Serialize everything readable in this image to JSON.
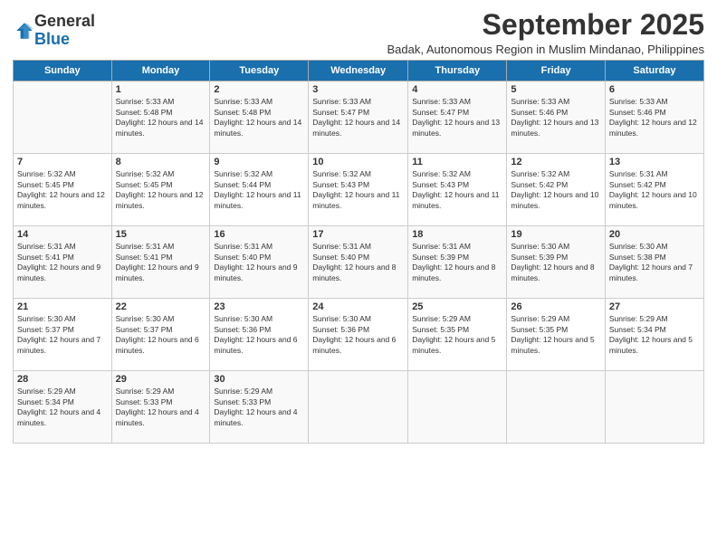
{
  "header": {
    "logo_line1": "General",
    "logo_line2": "Blue",
    "month": "September 2025",
    "location": "Badak, Autonomous Region in Muslim Mindanao, Philippines"
  },
  "days_of_week": [
    "Sunday",
    "Monday",
    "Tuesday",
    "Wednesday",
    "Thursday",
    "Friday",
    "Saturday"
  ],
  "weeks": [
    [
      {
        "day": "",
        "sunrise": "",
        "sunset": "",
        "daylight": ""
      },
      {
        "day": "1",
        "sunrise": "Sunrise: 5:33 AM",
        "sunset": "Sunset: 5:48 PM",
        "daylight": "Daylight: 12 hours and 14 minutes."
      },
      {
        "day": "2",
        "sunrise": "Sunrise: 5:33 AM",
        "sunset": "Sunset: 5:48 PM",
        "daylight": "Daylight: 12 hours and 14 minutes."
      },
      {
        "day": "3",
        "sunrise": "Sunrise: 5:33 AM",
        "sunset": "Sunset: 5:47 PM",
        "daylight": "Daylight: 12 hours and 14 minutes."
      },
      {
        "day": "4",
        "sunrise": "Sunrise: 5:33 AM",
        "sunset": "Sunset: 5:47 PM",
        "daylight": "Daylight: 12 hours and 13 minutes."
      },
      {
        "day": "5",
        "sunrise": "Sunrise: 5:33 AM",
        "sunset": "Sunset: 5:46 PM",
        "daylight": "Daylight: 12 hours and 13 minutes."
      },
      {
        "day": "6",
        "sunrise": "Sunrise: 5:33 AM",
        "sunset": "Sunset: 5:46 PM",
        "daylight": "Daylight: 12 hours and 12 minutes."
      }
    ],
    [
      {
        "day": "7",
        "sunrise": "Sunrise: 5:32 AM",
        "sunset": "Sunset: 5:45 PM",
        "daylight": "Daylight: 12 hours and 12 minutes."
      },
      {
        "day": "8",
        "sunrise": "Sunrise: 5:32 AM",
        "sunset": "Sunset: 5:45 PM",
        "daylight": "Daylight: 12 hours and 12 minutes."
      },
      {
        "day": "9",
        "sunrise": "Sunrise: 5:32 AM",
        "sunset": "Sunset: 5:44 PM",
        "daylight": "Daylight: 12 hours and 11 minutes."
      },
      {
        "day": "10",
        "sunrise": "Sunrise: 5:32 AM",
        "sunset": "Sunset: 5:43 PM",
        "daylight": "Daylight: 12 hours and 11 minutes."
      },
      {
        "day": "11",
        "sunrise": "Sunrise: 5:32 AM",
        "sunset": "Sunset: 5:43 PM",
        "daylight": "Daylight: 12 hours and 11 minutes."
      },
      {
        "day": "12",
        "sunrise": "Sunrise: 5:32 AM",
        "sunset": "Sunset: 5:42 PM",
        "daylight": "Daylight: 12 hours and 10 minutes."
      },
      {
        "day": "13",
        "sunrise": "Sunrise: 5:31 AM",
        "sunset": "Sunset: 5:42 PM",
        "daylight": "Daylight: 12 hours and 10 minutes."
      }
    ],
    [
      {
        "day": "14",
        "sunrise": "Sunrise: 5:31 AM",
        "sunset": "Sunset: 5:41 PM",
        "daylight": "Daylight: 12 hours and 9 minutes."
      },
      {
        "day": "15",
        "sunrise": "Sunrise: 5:31 AM",
        "sunset": "Sunset: 5:41 PM",
        "daylight": "Daylight: 12 hours and 9 minutes."
      },
      {
        "day": "16",
        "sunrise": "Sunrise: 5:31 AM",
        "sunset": "Sunset: 5:40 PM",
        "daylight": "Daylight: 12 hours and 9 minutes."
      },
      {
        "day": "17",
        "sunrise": "Sunrise: 5:31 AM",
        "sunset": "Sunset: 5:40 PM",
        "daylight": "Daylight: 12 hours and 8 minutes."
      },
      {
        "day": "18",
        "sunrise": "Sunrise: 5:31 AM",
        "sunset": "Sunset: 5:39 PM",
        "daylight": "Daylight: 12 hours and 8 minutes."
      },
      {
        "day": "19",
        "sunrise": "Sunrise: 5:30 AM",
        "sunset": "Sunset: 5:39 PM",
        "daylight": "Daylight: 12 hours and 8 minutes."
      },
      {
        "day": "20",
        "sunrise": "Sunrise: 5:30 AM",
        "sunset": "Sunset: 5:38 PM",
        "daylight": "Daylight: 12 hours and 7 minutes."
      }
    ],
    [
      {
        "day": "21",
        "sunrise": "Sunrise: 5:30 AM",
        "sunset": "Sunset: 5:37 PM",
        "daylight": "Daylight: 12 hours and 7 minutes."
      },
      {
        "day": "22",
        "sunrise": "Sunrise: 5:30 AM",
        "sunset": "Sunset: 5:37 PM",
        "daylight": "Daylight: 12 hours and 6 minutes."
      },
      {
        "day": "23",
        "sunrise": "Sunrise: 5:30 AM",
        "sunset": "Sunset: 5:36 PM",
        "daylight": "Daylight: 12 hours and 6 minutes."
      },
      {
        "day": "24",
        "sunrise": "Sunrise: 5:30 AM",
        "sunset": "Sunset: 5:36 PM",
        "daylight": "Daylight: 12 hours and 6 minutes."
      },
      {
        "day": "25",
        "sunrise": "Sunrise: 5:29 AM",
        "sunset": "Sunset: 5:35 PM",
        "daylight": "Daylight: 12 hours and 5 minutes."
      },
      {
        "day": "26",
        "sunrise": "Sunrise: 5:29 AM",
        "sunset": "Sunset: 5:35 PM",
        "daylight": "Daylight: 12 hours and 5 minutes."
      },
      {
        "day": "27",
        "sunrise": "Sunrise: 5:29 AM",
        "sunset": "Sunset: 5:34 PM",
        "daylight": "Daylight: 12 hours and 5 minutes."
      }
    ],
    [
      {
        "day": "28",
        "sunrise": "Sunrise: 5:29 AM",
        "sunset": "Sunset: 5:34 PM",
        "daylight": "Daylight: 12 hours and 4 minutes."
      },
      {
        "day": "29",
        "sunrise": "Sunrise: 5:29 AM",
        "sunset": "Sunset: 5:33 PM",
        "daylight": "Daylight: 12 hours and 4 minutes."
      },
      {
        "day": "30",
        "sunrise": "Sunrise: 5:29 AM",
        "sunset": "Sunset: 5:33 PM",
        "daylight": "Daylight: 12 hours and 4 minutes."
      },
      {
        "day": "",
        "sunrise": "",
        "sunset": "",
        "daylight": ""
      },
      {
        "day": "",
        "sunrise": "",
        "sunset": "",
        "daylight": ""
      },
      {
        "day": "",
        "sunrise": "",
        "sunset": "",
        "daylight": ""
      },
      {
        "day": "",
        "sunrise": "",
        "sunset": "",
        "daylight": ""
      }
    ]
  ]
}
